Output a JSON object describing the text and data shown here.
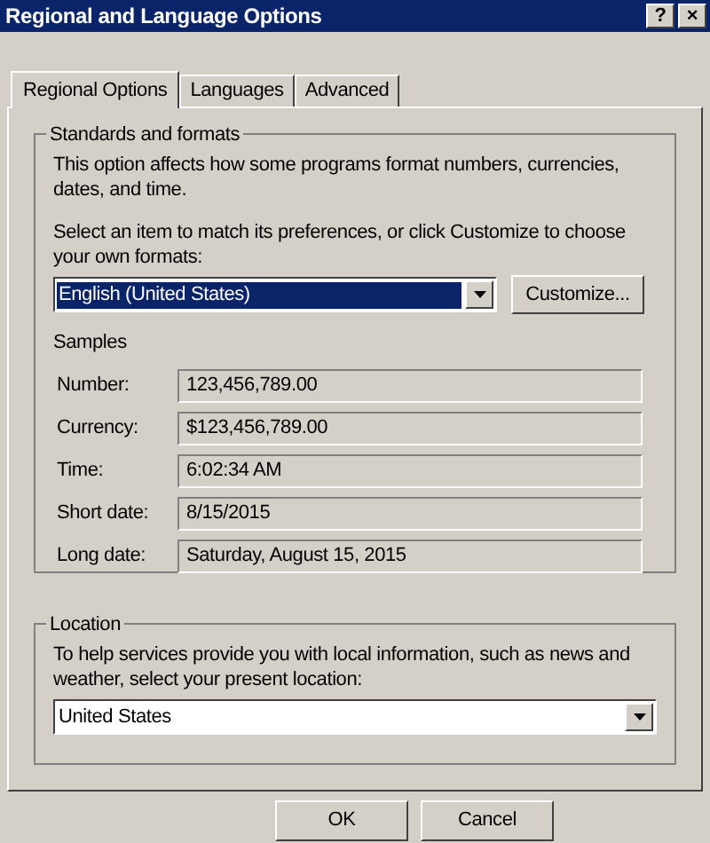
{
  "window": {
    "title": "Regional and Language Options",
    "controls": [
      "?",
      "×"
    ]
  },
  "tabs": [
    {
      "label": "Regional Options",
      "selected": true
    },
    {
      "label": "Languages",
      "selected": false
    },
    {
      "label": "Advanced",
      "selected": false
    }
  ],
  "standards": {
    "title": "Standards and formats",
    "description": "This option affects how some programs format numbers, currencies, dates, and time.",
    "prompt": "Select an item to match its preferences, or click Customize to choose your own formats:",
    "format": "English (United States)",
    "customize": "Customize...",
    "samples_title": "Samples",
    "samples": [
      {
        "label": "Number:",
        "value": "123,456,789.00"
      },
      {
        "label": "Currency:",
        "value": "$123,456,789.00"
      },
      {
        "label": "Time:",
        "value": "6:02:34 AM"
      },
      {
        "label": "Short date:",
        "value": "8/15/2015"
      },
      {
        "label": "Long date:",
        "value": "Saturday, August 15, 2015"
      }
    ]
  },
  "location": {
    "title": "Location",
    "description": "To help services provide you with local information, such as news and weather, select your present location:",
    "value": "United States"
  },
  "buttons": [
    "OK",
    "Cancel"
  ]
}
